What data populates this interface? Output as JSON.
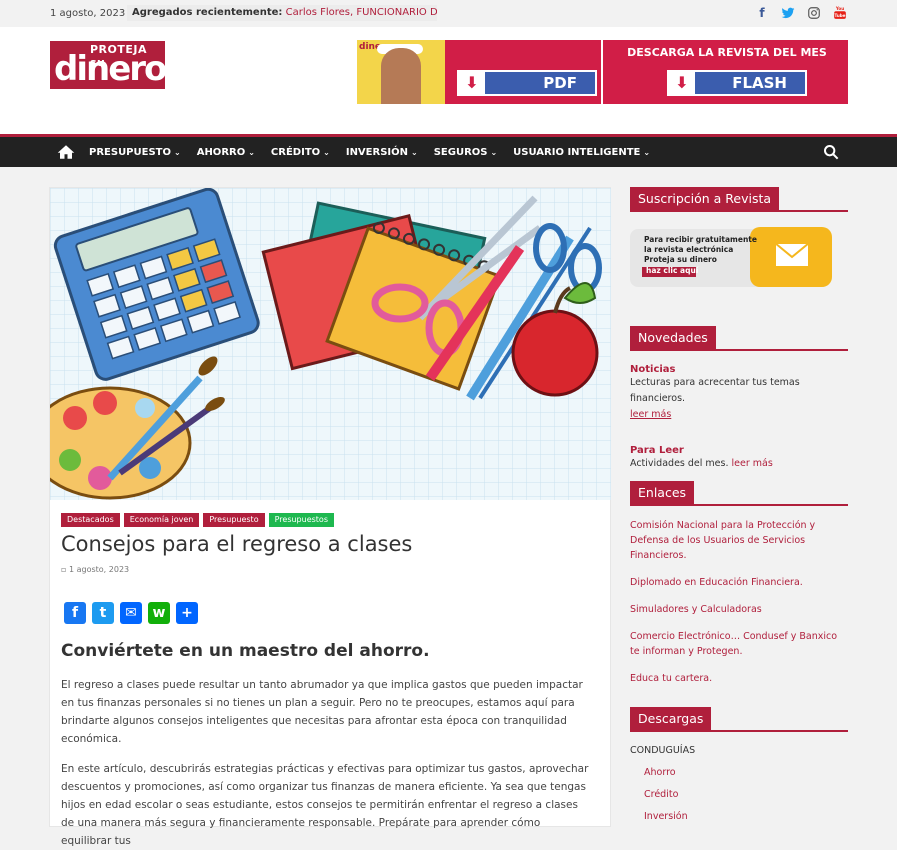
{
  "topbar": {
    "date": "1 agosto, 2023",
    "recent_label": "Agregados recientemente:",
    "recent_value": "Carlos Flores, FUNCIONARIO DE LA",
    "social": [
      "facebook-icon",
      "twitter-icon",
      "instagram-icon",
      "youtube-icon"
    ]
  },
  "header": {
    "logo_top": "PROTEJA su",
    "logo_main": "dinero",
    "banner_title": "DESCARGA LA REVISTA DEL MES",
    "banner_pdf": "PDF",
    "banner_flash": "FLASH",
    "banner_mag_text": "dinero"
  },
  "nav": {
    "items": [
      "PRESUPUESTO",
      "AHORRO",
      "CRÉDITO",
      "INVERSIÓN",
      "SEGUROS",
      "USUARIO INTELIGENTE"
    ]
  },
  "post": {
    "tags": [
      "Destacados",
      "Economía joven",
      "Presupuesto",
      "Presupuestos"
    ],
    "title": "Consejos para el regreso a clases",
    "date": "1 agosto, 2023",
    "share": [
      "f",
      "t",
      "✉",
      "w",
      "+"
    ],
    "subheading": "Conviértete en un maestro del ahorro.",
    "p1": "El regreso a clases puede resultar un tanto abrumador ya que implica gastos que pueden impactar en tus finanzas personales si no tienes un plan a seguir. Pero no te preocupes, estamos aquí para brindarte algunos consejos inteligentes que necesitas para afrontar esta época con tranquilidad económica.",
    "p2": "En este artículo, descubrirás estrategias prácticas y efectivas para optimizar tus gastos, aprovechar descuentos y promociones, así como organizar tus finanzas de manera eficiente. Ya sea que tengas hijos en edad escolar o seas estudiante, estos consejos te permitirán enfrentar el regreso a clases de una manera más segura y financieramente responsable. Prepárate para aprender cómo equilibrar tus"
  },
  "sidebar": {
    "subscription": {
      "title": "Suscripción a Revista",
      "card_l1": "Para recibir gratuitamente",
      "card_l2": "la revista electrónica",
      "card_l3": "Proteja su dinero",
      "card_btn": "haz clic aquí"
    },
    "novedades": {
      "title": "Novedades",
      "item1_head": "Noticias",
      "item1_text": "Lecturas para acrecentar tus temas financieros.",
      "item1_link": "leer más",
      "item2_head": "Para Leer",
      "item2_text": "Actividades del mes.",
      "item2_link": "leer más"
    },
    "enlaces": {
      "title": "Enlaces",
      "links": [
        "Comisión Nacional para la Protección y Defensa de los Usuarios de Servicios Financieros.",
        "Diplomado en Educación Financiera.",
        "Simuladores y Calculadoras",
        "Comercio Electrónico… Condusef y Banxico te informan y Protegen.",
        "Educa tu cartera."
      ]
    },
    "descargas": {
      "title": "Descargas",
      "parent": "CONDUGUÍAS",
      "children": [
        "Ahorro",
        "Crédito",
        "Inversión"
      ]
    }
  }
}
